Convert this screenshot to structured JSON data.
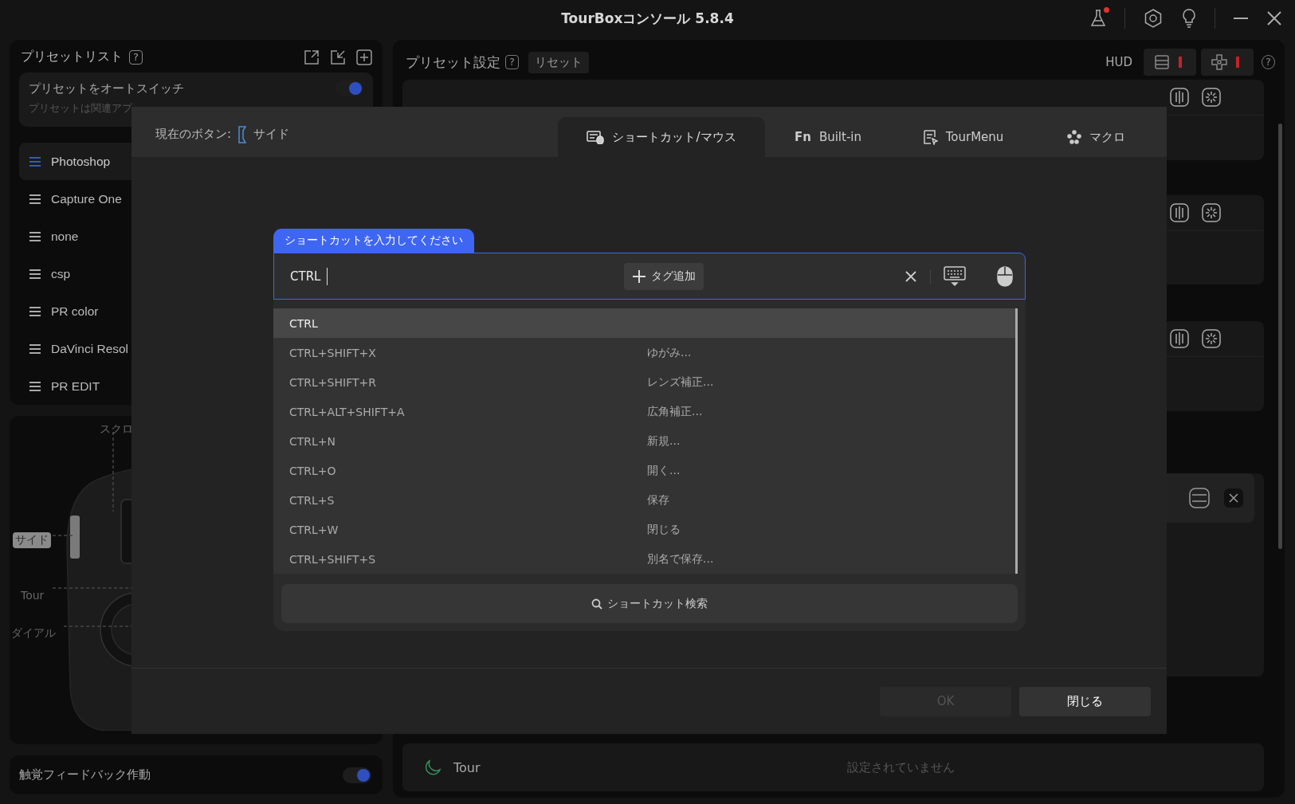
{
  "window": {
    "title": "TourBoxコンソール 5.8.4",
    "notification": true
  },
  "preset_list": {
    "title": "プリセットリスト",
    "help": "?",
    "auto_switch": {
      "label": "プリセットをオートスイッチ",
      "description": "プリセットは関連アプ",
      "on": true
    },
    "items": [
      {
        "name": "Photoshop",
        "selected": true
      },
      {
        "name": "Capture One",
        "selected": false
      },
      {
        "name": "none",
        "selected": false
      },
      {
        "name": "csp",
        "selected": false
      },
      {
        "name": "PR color",
        "selected": false
      },
      {
        "name": "DaVinci Resol",
        "selected": false
      },
      {
        "name": "PR EDIT",
        "selected": false
      }
    ]
  },
  "device": {
    "labels": [
      {
        "text": "スクロ",
        "kind": "plain"
      },
      {
        "text": "サイド",
        "kind": "highlighted"
      },
      {
        "text": "Tour",
        "kind": "plain"
      },
      {
        "text": "ダイアル",
        "kind": "plain"
      }
    ]
  },
  "haptic": {
    "label": "触覚フィードバック作動",
    "on": true
  },
  "preset_settings": {
    "title": "プリセット設定",
    "help": "?",
    "reset": "リセット",
    "hud": "HUD",
    "hud_help": "?",
    "tour_row": {
      "name": "Tour",
      "value": "設定されていません"
    }
  },
  "modal": {
    "current_label": "現在のボタン:",
    "current_button": "サイド",
    "tabs": [
      {
        "label": "ショートカット/マウス",
        "selected": true
      },
      {
        "label": "Built-in",
        "badge": "Fn",
        "selected": false
      },
      {
        "label": "TourMenu",
        "selected": false
      },
      {
        "label": "マクロ",
        "selected": false
      }
    ],
    "input": {
      "label": "ショートカットを入力してください",
      "value": "CTRL",
      "add_tag": "タグ追加"
    },
    "suggestions": [
      {
        "keys": "CTRL",
        "selected": true
      },
      {
        "keys": "CTRL+SHIFT+X",
        "description": "ゆがみ...",
        "selected": false
      },
      {
        "keys": "CTRL+SHIFT+R",
        "description": "レンズ補正...",
        "selected": false
      },
      {
        "keys": "CTRL+ALT+SHIFT+A",
        "description": "広角補正...",
        "selected": false
      },
      {
        "keys": "CTRL+N",
        "description": "新規...",
        "selected": false
      },
      {
        "keys": "CTRL+O",
        "description": "開く...",
        "selected": false
      },
      {
        "keys": "CTRL+S",
        "description": "保存",
        "selected": false
      },
      {
        "keys": "CTRL+W",
        "description": "閉じる",
        "selected": false
      },
      {
        "keys": "CTRL+SHIFT+S",
        "description": "別名で保存...",
        "selected": false
      }
    ],
    "search": "ショートカット検索",
    "buttons": [
      {
        "label": "OK",
        "disabled": true
      },
      {
        "label": "閉じる",
        "disabled": false
      }
    ]
  }
}
